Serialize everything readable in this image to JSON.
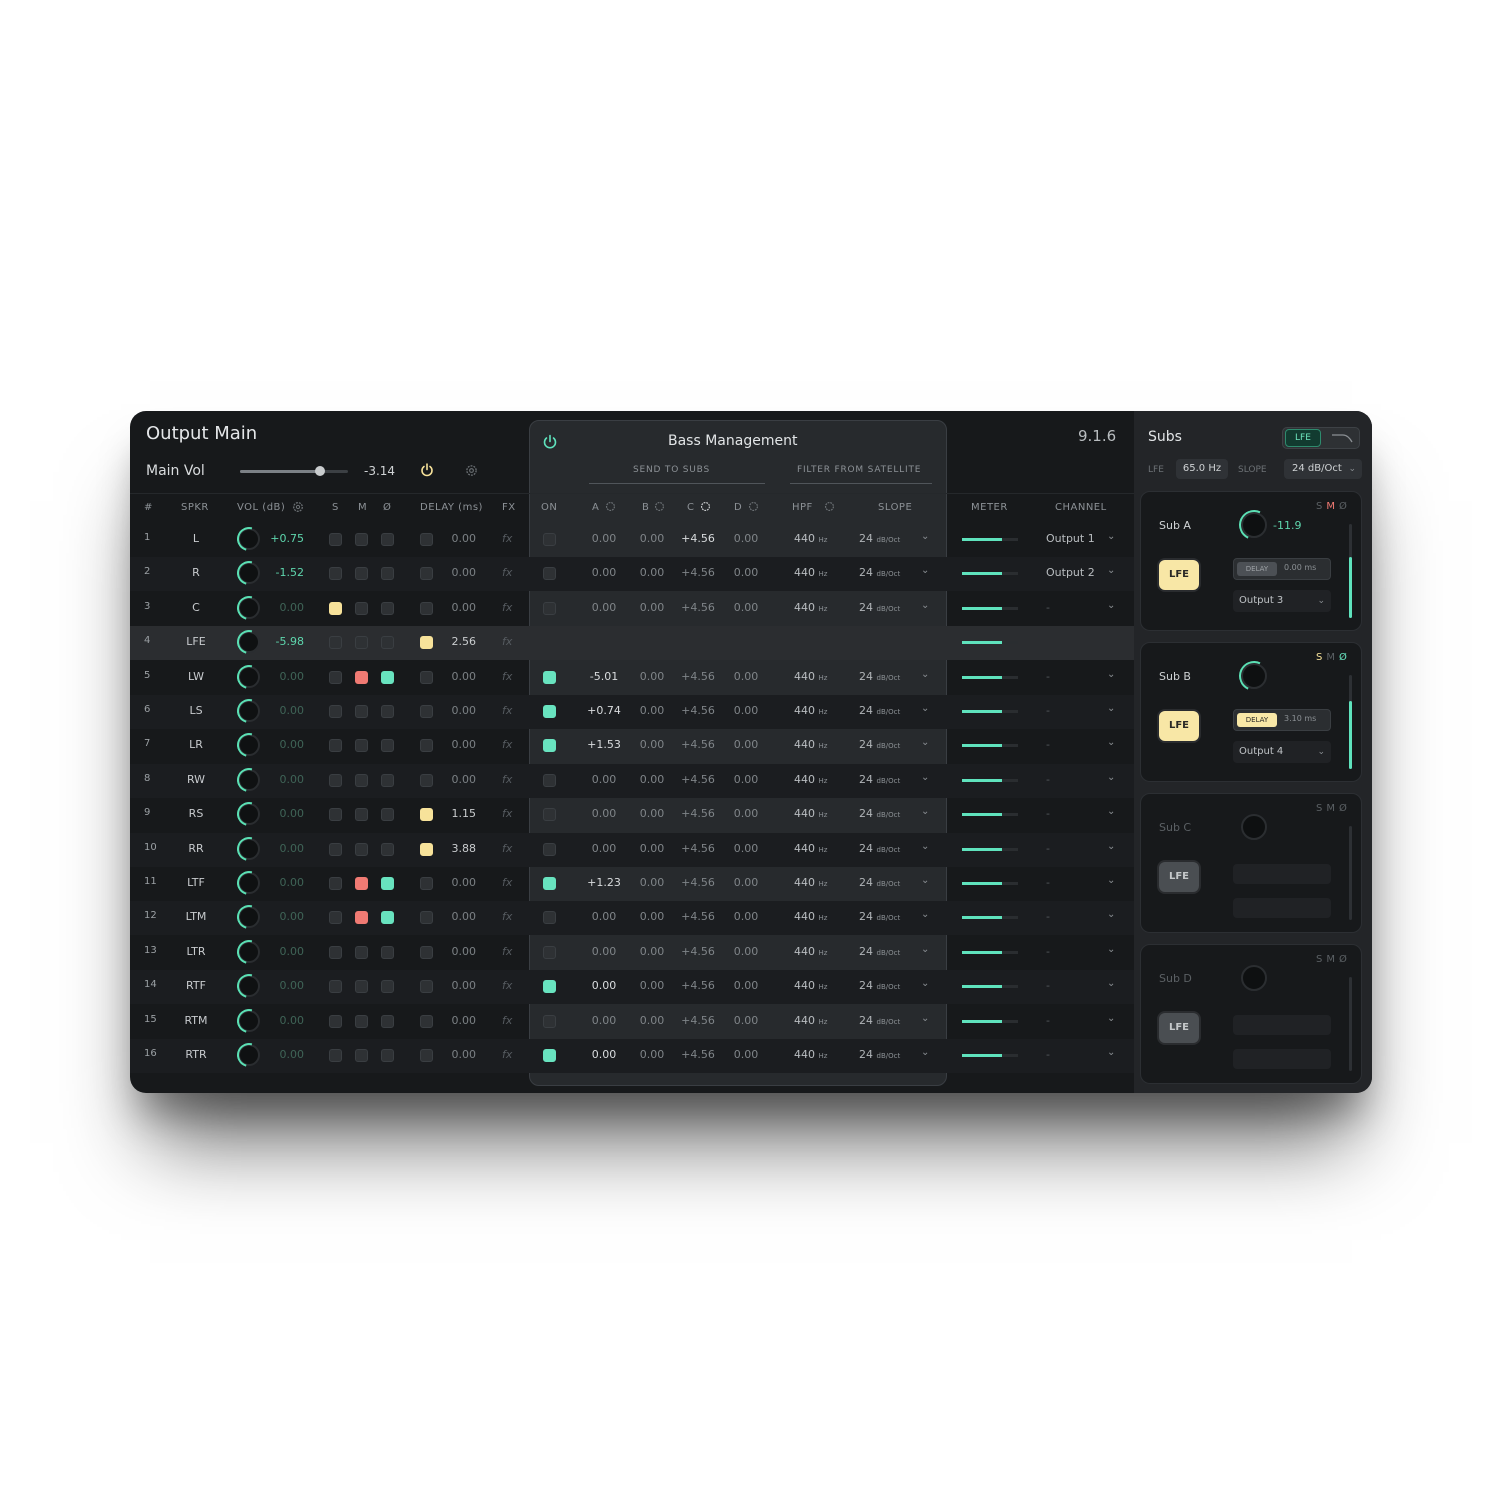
{
  "window": {
    "title": "Output Main",
    "version": "9.1.6"
  },
  "main_vol": {
    "label": "Main Vol",
    "value": "-3.14",
    "level": 0.74
  },
  "headers": {
    "num": "#",
    "spkr": "SPKR",
    "vol": "VOL (dB)",
    "s": "S",
    "m": "M",
    "z": "Ø",
    "delay": "DELAY (ms)",
    "fx": "FX",
    "on": "ON",
    "a": "A",
    "b": "B",
    "c": "C",
    "d": "D",
    "hpf": "HPF",
    "slope": "SLOPE",
    "meter": "METER",
    "channel": "CHANNEL"
  },
  "bass_management": {
    "title": "Bass Management",
    "send_to_subs": "SEND TO SUBS",
    "filter_from_satellite": "FILTER FROM SATELLITE",
    "hpf_unit": "Hz",
    "slope_unit": "dB/Oct"
  },
  "rows": [
    {
      "n": "1",
      "spkr": "L",
      "vol": "+0.75",
      "vol_on": true,
      "s": "off",
      "m": "off",
      "z": "off",
      "delay_on": false,
      "delay": "0.00",
      "fx": "fx",
      "on": false,
      "a": "0.00",
      "b": "0.00",
      "c": "+4.56",
      "d": "0.00",
      "hpf": "440",
      "slope": "24",
      "meter": 0.72,
      "channel": "Output 1"
    },
    {
      "n": "2",
      "spkr": "R",
      "vol": "-1.52",
      "vol_on": true,
      "s": "off",
      "m": "off",
      "z": "off",
      "delay_on": false,
      "delay": "0.00",
      "fx": "fx",
      "on": false,
      "a": "0.00",
      "b": "0.00",
      "c": "+4.56",
      "d": "0.00",
      "hpf": "440",
      "slope": "24",
      "meter": 0.72,
      "channel": "Output 2"
    },
    {
      "n": "3",
      "spkr": "C",
      "vol": "0.00",
      "vol_on": false,
      "s": "yellow",
      "m": "off",
      "z": "off",
      "delay_on": false,
      "delay": "0.00",
      "fx": "fx",
      "on": false,
      "a": "0.00",
      "b": "0.00",
      "c": "+4.56",
      "d": "0.00",
      "hpf": "440",
      "slope": "24",
      "meter": 0.72,
      "channel": "-"
    },
    {
      "n": "4",
      "spkr": "LFE",
      "vol": "-5.98",
      "vol_on": true,
      "s": "off",
      "m": "off",
      "z": "off",
      "delay_on": true,
      "delay": "2.56",
      "fx": "fx",
      "lfe": true,
      "meter": 0.72,
      "channel": ""
    },
    {
      "n": "5",
      "spkr": "LW",
      "vol": "0.00",
      "vol_on": false,
      "s": "off",
      "m": "red",
      "z": "green",
      "delay_on": false,
      "delay": "0.00",
      "fx": "fx",
      "on": true,
      "a": "-5.01",
      "b": "0.00",
      "c": "+4.56",
      "d": "0.00",
      "hpf": "440",
      "slope": "24",
      "meter": 0.72,
      "channel": "-"
    },
    {
      "n": "6",
      "spkr": "LS",
      "vol": "0.00",
      "vol_on": false,
      "s": "off",
      "m": "off",
      "z": "off",
      "delay_on": false,
      "delay": "0.00",
      "fx": "fx",
      "on": true,
      "a": "+0.74",
      "b": "0.00",
      "c": "+4.56",
      "d": "0.00",
      "hpf": "440",
      "slope": "24",
      "meter": 0.72,
      "channel": "-"
    },
    {
      "n": "7",
      "spkr": "LR",
      "vol": "0.00",
      "vol_on": false,
      "s": "off",
      "m": "off",
      "z": "off",
      "delay_on": false,
      "delay": "0.00",
      "fx": "fx",
      "on": true,
      "a": "+1.53",
      "b": "0.00",
      "c": "+4.56",
      "d": "0.00",
      "hpf": "440",
      "slope": "24",
      "meter": 0.72,
      "channel": "-"
    },
    {
      "n": "8",
      "spkr": "RW",
      "vol": "0.00",
      "vol_on": false,
      "s": "off",
      "m": "off",
      "z": "off",
      "delay_on": false,
      "delay": "0.00",
      "fx": "fx",
      "on": false,
      "a": "0.00",
      "b": "0.00",
      "c": "+4.56",
      "d": "0.00",
      "hpf": "440",
      "slope": "24",
      "meter": 0.72,
      "channel": "-"
    },
    {
      "n": "9",
      "spkr": "RS",
      "vol": "0.00",
      "vol_on": false,
      "s": "off",
      "m": "off",
      "z": "off",
      "delay_on": true,
      "delay": "1.15",
      "fx": "fx",
      "on": false,
      "a": "0.00",
      "b": "0.00",
      "c": "+4.56",
      "d": "0.00",
      "hpf": "440",
      "slope": "24",
      "meter": 0.72,
      "channel": "-"
    },
    {
      "n": "10",
      "spkr": "RR",
      "vol": "0.00",
      "vol_on": false,
      "s": "off",
      "m": "off",
      "z": "off",
      "delay_on": true,
      "delay": "3.88",
      "fx": "fx",
      "on": false,
      "a": "0.00",
      "b": "0.00",
      "c": "+4.56",
      "d": "0.00",
      "hpf": "440",
      "slope": "24",
      "meter": 0.72,
      "channel": "-"
    },
    {
      "n": "11",
      "spkr": "LTF",
      "vol": "0.00",
      "vol_on": false,
      "s": "off",
      "m": "red",
      "z": "green",
      "delay_on": false,
      "delay": "0.00",
      "fx": "fx",
      "on": true,
      "a": "+1.23",
      "b": "0.00",
      "c": "+4.56",
      "d": "0.00",
      "hpf": "440",
      "slope": "24",
      "meter": 0.72,
      "channel": "-"
    },
    {
      "n": "12",
      "spkr": "LTM",
      "vol": "0.00",
      "vol_on": false,
      "s": "off",
      "m": "red",
      "z": "green",
      "delay_on": false,
      "delay": "0.00",
      "fx": "fx",
      "on": false,
      "a": "0.00",
      "b": "0.00",
      "c": "+4.56",
      "d": "0.00",
      "hpf": "440",
      "slope": "24",
      "meter": 0.72,
      "channel": "-"
    },
    {
      "n": "13",
      "spkr": "LTR",
      "vol": "0.00",
      "vol_on": false,
      "s": "off",
      "m": "off",
      "z": "off",
      "delay_on": false,
      "delay": "0.00",
      "fx": "fx",
      "on": false,
      "a": "0.00",
      "b": "0.00",
      "c": "+4.56",
      "d": "0.00",
      "hpf": "440",
      "slope": "24",
      "meter": 0.72,
      "channel": "-"
    },
    {
      "n": "14",
      "spkr": "RTF",
      "vol": "0.00",
      "vol_on": false,
      "s": "off",
      "m": "off",
      "z": "off",
      "delay_on": false,
      "delay": "0.00",
      "fx": "fx",
      "on": true,
      "a": "0.00",
      "b": "0.00",
      "c": "+4.56",
      "d": "0.00",
      "hpf": "440",
      "slope": "24",
      "meter": 0.72,
      "channel": "-"
    },
    {
      "n": "15",
      "spkr": "RTM",
      "vol": "0.00",
      "vol_on": false,
      "s": "off",
      "m": "off",
      "z": "off",
      "delay_on": false,
      "delay": "0.00",
      "fx": "fx",
      "on": false,
      "a": "0.00",
      "b": "0.00",
      "c": "+4.56",
      "d": "0.00",
      "hpf": "440",
      "slope": "24",
      "meter": 0.72,
      "channel": "-"
    },
    {
      "n": "16",
      "spkr": "RTR",
      "vol": "0.00",
      "vol_on": false,
      "s": "off",
      "m": "off",
      "z": "off",
      "delay_on": false,
      "delay": "0.00",
      "fx": "fx",
      "on": true,
      "a": "0.00",
      "b": "0.00",
      "c": "+4.56",
      "d": "0.00",
      "hpf": "440",
      "slope": "24",
      "meter": 0.72,
      "channel": "-"
    }
  ],
  "subs": {
    "title": "Subs",
    "lfe_toggle_label": "LFE",
    "lfe_label": "LFE",
    "lfe_value": "65.0 Hz",
    "slope_label": "SLOPE",
    "slope_value": "24 dB/Oct",
    "s_label": "S",
    "m_label": "M",
    "z_label": "Ø",
    "cards": [
      {
        "name": "Sub A",
        "vol": "-11.9",
        "active": true,
        "lfe_on": true,
        "m": "red",
        "s": "off",
        "z": "off",
        "delay_label": "DELAY",
        "delay_on": false,
        "delay_value": "0.00 ms",
        "output": "Output 3",
        "level": 0.65
      },
      {
        "name": "Sub B",
        "vol": "",
        "active": true,
        "lfe_on": true,
        "m": "off",
        "s": "yellow",
        "z": "green",
        "delay_label": "DELAY",
        "delay_on": true,
        "delay_value": "3.10 ms",
        "output": "Output 4",
        "level": 0.72
      },
      {
        "name": "Sub C",
        "vol": "",
        "active": false,
        "lfe_on": false,
        "m": "off",
        "s": "off",
        "z": "off",
        "level": 0
      },
      {
        "name": "Sub D",
        "vol": "",
        "active": false,
        "lfe_on": false,
        "m": "off",
        "s": "off",
        "z": "off",
        "level": 0
      }
    ]
  },
  "colors": {
    "accent_green": "#5fe3bd",
    "mute_red": "#f07a73",
    "solo_yellow": "#f7e29a",
    "bg": "#17191b"
  }
}
